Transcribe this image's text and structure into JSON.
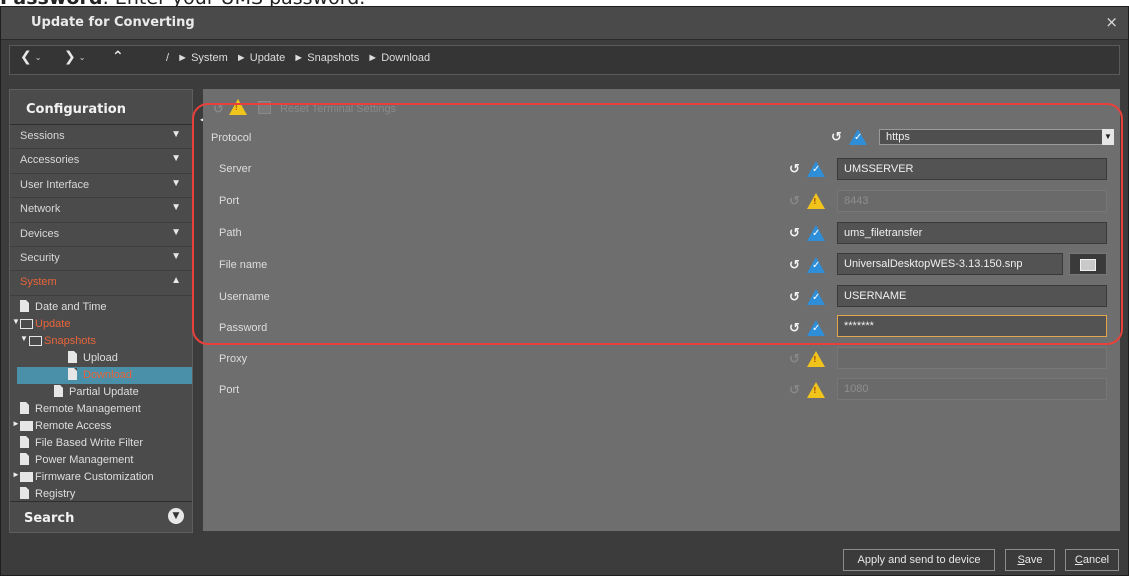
{
  "caption": {
    "bold": "Password",
    "rest": ": Enter your UMS password."
  },
  "window": {
    "title": "Update for Converting",
    "close": "×"
  },
  "nav": {
    "back": "❮",
    "forward": "❯",
    "up": "⌃",
    "dropdown": "⌄",
    "breadcrumb": [
      "/",
      "► System",
      "► Update",
      "► Snapshots",
      "► Download"
    ]
  },
  "sidebar": {
    "heading": "Configuration",
    "categories": [
      {
        "label": "Sessions",
        "arrow": "▼"
      },
      {
        "label": "Accessories",
        "arrow": "▼"
      },
      {
        "label": "User Interface",
        "arrow": "▼"
      },
      {
        "label": "Network",
        "arrow": "▼"
      },
      {
        "label": "Devices",
        "arrow": "▼"
      },
      {
        "label": "Security",
        "arrow": "▼"
      },
      {
        "label": "System",
        "arrow": "▲"
      }
    ],
    "tree": {
      "date_time": "Date and Time",
      "update": "Update",
      "snapshots": "Snapshots",
      "upload": "Upload",
      "download": "Download",
      "partial_update": "Partial Update",
      "remote_management": "Remote Management",
      "remote_access": "Remote Access",
      "fbwf": "File Based Write Filter",
      "power_management": "Power Management",
      "firmware_customization": "Firmware Customization",
      "registry": "Registry"
    },
    "search": "Search",
    "search_icon": "▼"
  },
  "main": {
    "reset_label": "Reset Terminal Settings",
    "protocol": {
      "label": "Protocol",
      "value": "https",
      "dd": "▼"
    },
    "rows": [
      {
        "label": "Server",
        "value": "UMSSERVER"
      },
      {
        "label": "Port",
        "value": "8443"
      },
      {
        "label": "Path",
        "value": "ums_filetransfer"
      },
      {
        "label": "File name",
        "value": "UniversalDesktopWES-3.13.150.snp"
      },
      {
        "label": "Username",
        "value": "USERNAME"
      },
      {
        "label": "Password",
        "value": "*******"
      },
      {
        "label": "Proxy",
        "value": ""
      },
      {
        "label": "Port",
        "value": "1080"
      }
    ]
  },
  "footer": {
    "apply": "Apply and send to device",
    "save_u": "S",
    "save_rest": "ave",
    "cancel_u": "C",
    "cancel_rest": "ancel"
  },
  "icons": {
    "undo": "↺",
    "check": "✓",
    "warn": "!"
  },
  "colors": {
    "active_orange": "#e8643a",
    "selection_blue": "#4a90a8",
    "highlight_red": "#e8413c",
    "check_blue": "#2f8ed8",
    "warn_yellow": "#f0c41a"
  }
}
